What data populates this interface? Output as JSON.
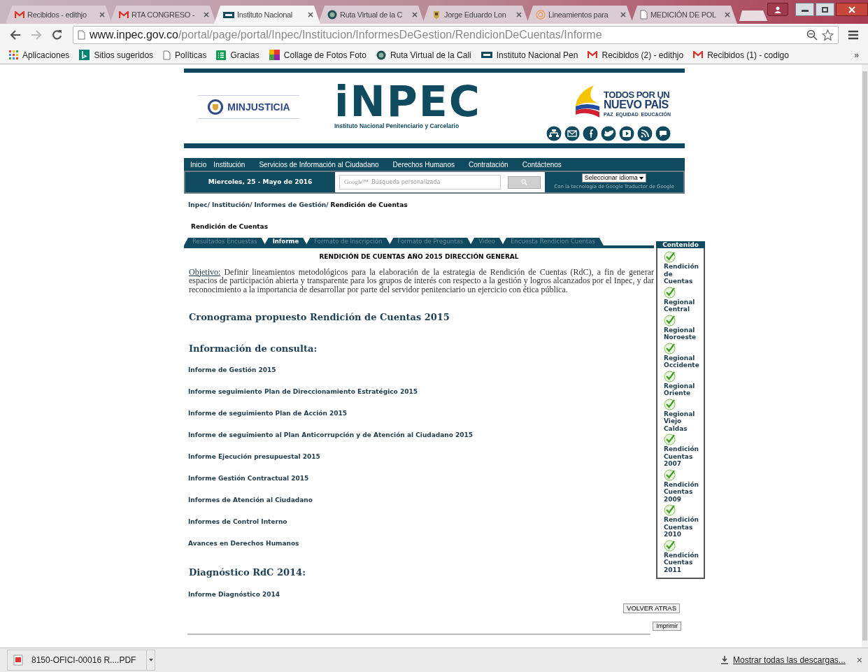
{
  "browser": {
    "tabs": [
      {
        "title": "Recibidos - edithjo",
        "kind": "gmail",
        "selected": false
      },
      {
        "title": "RTA CONGRESO -",
        "kind": "gmail",
        "selected": false
      },
      {
        "title": "Instituto Nacional",
        "kind": "inpec",
        "selected": true
      },
      {
        "title": "Ruta Virtual de la C",
        "kind": "seal",
        "selected": false
      },
      {
        "title": "Jorge Eduardo Lon",
        "kind": "crest",
        "selected": false
      },
      {
        "title": "Lineamientos para",
        "kind": "spiral",
        "selected": false
      },
      {
        "title": "MEDICIÓN DE POL",
        "kind": "doc",
        "selected": false
      }
    ],
    "address": {
      "host": "www.inpec.gov.co",
      "path": "/portal/page/portal/Inpec/Institucion/InformesDeGestion/RendicionDeCuentas/Informe"
    },
    "bookmarks": [
      {
        "label": "Aplicaciones",
        "kind": "apps"
      },
      {
        "label": "Sitios sugeridos",
        "kind": "bing"
      },
      {
        "label": "Políticas",
        "kind": "doc"
      },
      {
        "label": "Gracias",
        "kind": "sheet"
      },
      {
        "label": "Collage de Fotos Foto",
        "kind": "collage"
      },
      {
        "label": "Ruta Virtual de la Cali",
        "kind": "seal"
      },
      {
        "label": "Instituto Nacional Pen",
        "kind": "inpec"
      },
      {
        "label": "Recibidos (2) - edithjo",
        "kind": "gmail"
      },
      {
        "label": "Recibidos (1) - codigo",
        "kind": "gmail"
      }
    ],
    "bookmarks_more": "»"
  },
  "header": {
    "ministry": "MINJUSTICIA",
    "logo": "iNPEC",
    "logo_subtitle": "Instituto Nacional Penitenciario y Carcelario",
    "slogan_1": "TODOS POR UN",
    "slogan_2": "NUEVO PAÍS",
    "slogan_3": "PAZ  EQUIDAD  EDUCACIÓN"
  },
  "nav": {
    "items": [
      "Inicio",
      "Institución",
      "Servicios de Información al Ciudadano",
      "Derechos Humanos",
      "Contratación",
      "Contáctenos"
    ],
    "date": "Miercoles, 25 - Mayo de 2016",
    "search_brand": "Google™",
    "search_placeholder": "Búsqueda personalizada",
    "language": "Seleccionar idioma",
    "powered_by": "Con la tecnología de",
    "powered_brand": "Google",
    "translator": "Traductor de Google"
  },
  "breadcrumb": {
    "links": [
      "Inpec/",
      "Institución/",
      "Informes de Gestión/"
    ],
    "current": "Rendición de Cuentas"
  },
  "page_title": "Rendición de Cuentas",
  "content_tabs": [
    {
      "label": "Resultados Encuestas",
      "selected": false
    },
    {
      "label": "Informe",
      "selected": true
    },
    {
      "label": "Formato de Inscripción",
      "selected": false
    },
    {
      "label": "Formato de Preguntas",
      "selected": false
    },
    {
      "label": "Video",
      "selected": false
    },
    {
      "label": "Encuesta Rendicion Cuentas",
      "selected": false
    }
  ],
  "main": {
    "heading": "RENDICIÓN DE CUENTAS AÑO 2015 DIRECCIÓN GENERAL",
    "objective_label": "Objetivo:",
    "objective_text": "Definir lineamientos metodológicos para la elaboración de la estrategia de Rendición de Cuentas (RdC), a fin de generar espacios de participación abierta y transparente para los grupos de interés con respecto a la gestión y logros alcanzados por el Inpec, y dar reconocimiento a la importancia de desarrollar por parte del servidor penitenciario un ejercicio con ética pública.",
    "sections": [
      {
        "title": "Cronograma propuesto Rendición de Cuentas 2015"
      },
      {
        "title": "Información de consulta:",
        "links": [
          "Informe de Gestión 2015",
          "Informe seguimiento Plan de Direccionamiento Estratégico 2015",
          "Informe de seguimiento Plan de Acción 2015",
          "Informe de seguimiento al Plan Anticorrupción y de Atención al Ciudadano 2015",
          "Informe Ejecución presupuestal 2015",
          "Informe Gestión Contractual 2015",
          "Informes de Atención al Ciudadano",
          "Informes de Control Interno",
          "Avances en Derechos Humanos"
        ]
      },
      {
        "title": "Diagnóstico RdC 2014:",
        "links": [
          "Informe Diagnóstico 2014"
        ]
      }
    ]
  },
  "sidebar": {
    "title": "Contenido",
    "items": [
      "Rendición de Cuentas",
      "Regional Central",
      "Regional Noroeste",
      "Regional Occidente",
      "Regional Oriente",
      "Regional Viejo Caldas",
      "Rendición Cuentas 2007",
      "Rendición Cuentas 2009",
      "Rendición Cuentas 2010",
      "Rendición Cuentas 2011"
    ]
  },
  "buttons": {
    "back": "VOLVER ATRAS",
    "print": "Imprimir"
  },
  "downloads": {
    "file": "8150-OFICI-00016 R....PDF",
    "show_all": "Mostrar todas las descargas...",
    "close": "×"
  }
}
